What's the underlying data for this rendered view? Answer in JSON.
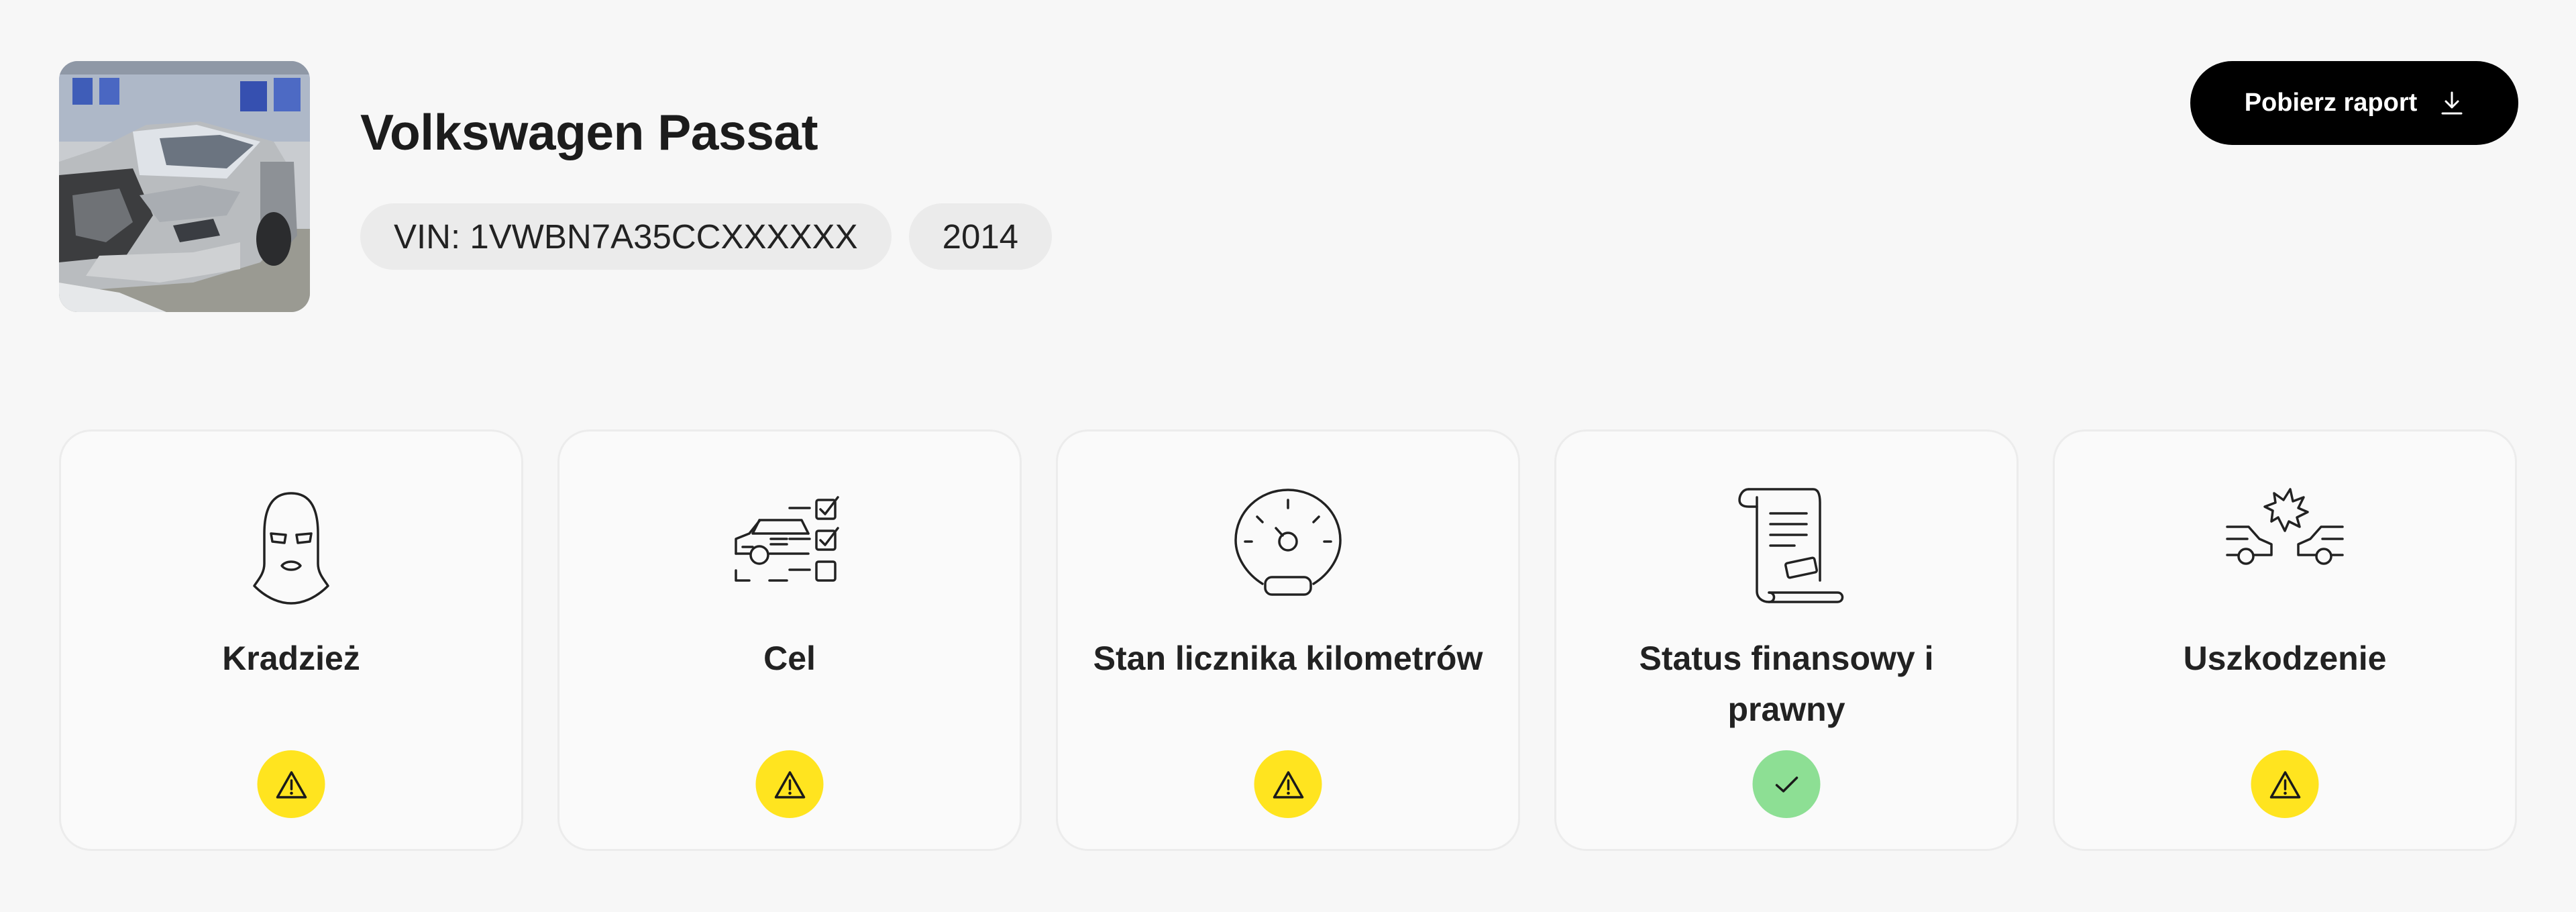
{
  "vehicle": {
    "title": "Volkswagen Passat",
    "vin": "VIN: 1VWBN7A35CCXXXXXX",
    "year": "2014",
    "photo_alt": "vehicle-photo"
  },
  "actions": {
    "download_label": "Pobierz raport",
    "download_icon": "download-icon"
  },
  "colors": {
    "button_bg": "#000000",
    "chip_bg": "#ebebeb",
    "warning": "#ffe41f",
    "ok": "#8ddf94"
  },
  "cards": [
    {
      "label": "Kradzież",
      "icon": "balaclava-icon",
      "status": "warning"
    },
    {
      "label": "Cel",
      "icon": "car-checklist-icon",
      "status": "warning"
    },
    {
      "label": "Stan licznika kilometrów",
      "icon": "odometer-icon",
      "status": "warning"
    },
    {
      "label": "Status finansowy i prawny",
      "icon": "document-scroll-icon",
      "status": "ok"
    },
    {
      "label": "Uszkodzenie",
      "icon": "car-collision-icon",
      "status": "warning"
    }
  ]
}
